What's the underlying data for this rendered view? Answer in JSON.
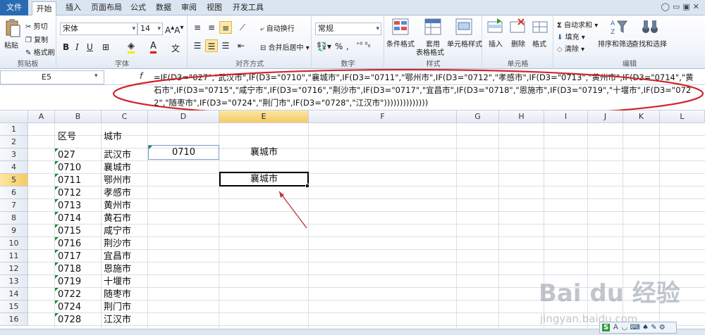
{
  "ribbon_tabs": [
    "文件",
    "开始",
    "插入",
    "页面布局",
    "公式",
    "数据",
    "审阅",
    "视图",
    "开发工具"
  ],
  "active_tab": "开始",
  "clipboard": {
    "paste": "粘贴",
    "cut": "剪切",
    "copy": "复制",
    "format_painter": "格式刷",
    "label": "剪贴板"
  },
  "font": {
    "name": "宋体",
    "size": "14",
    "label": "字体"
  },
  "alignment": {
    "wrap": "自动换行",
    "merge": "合并后居中",
    "label": "对齐方式"
  },
  "number": {
    "format": "常规",
    "percent": "%",
    "comma": ",",
    "label": "数字"
  },
  "styles": {
    "conditional": "条件格式",
    "table_line1": "套用",
    "table_line2": "表格格式",
    "cell_styles": "单元格样式",
    "label": "样式"
  },
  "cells": {
    "insert": "插入",
    "delete": "删除",
    "format": "格式",
    "label": "单元格"
  },
  "editing": {
    "autosum": "自动求和",
    "fill": "填充",
    "clear": "清除",
    "sort": "排序和筛选",
    "find": "查找和选择",
    "label": "编辑"
  },
  "name_box": "E5",
  "fx": "f",
  "formula": "=IF(D3=\"027\",\"武汉市\",IF(D3=\"0710\",\"襄城市\",IF(D3=\"0711\",\"鄂州市\",IF(D3=\"0712\",\"孝感市\",IF(D3=\"0713\",\"黄州市\",IF(D3=\"0714\",\"黄石市\",IF(D3=\"0715\",\"咸宁市\",IF(D3=\"0716\",\"荆沙市\",IF(D3=\"0717\",\"宜昌市\",IF(D3=\"0718\",\"恩施市\",IF(D3=\"0719\",\"十堰市\",IF(D3=\"0722\",\"随枣市\",IF(D3=\"0724\",\"荆门市\",IF(D3=\"0728\",\"江汉市\"))))))))))))))",
  "columns": [
    "A",
    "B",
    "C",
    "D",
    "E",
    "F",
    "G",
    "H",
    "I",
    "J",
    "K",
    "L"
  ],
  "rows": [
    "1",
    "2",
    "3",
    "4",
    "5",
    "6",
    "7",
    "8",
    "9",
    "10",
    "11",
    "12",
    "13",
    "14",
    "15",
    "16"
  ],
  "selected_column": "E",
  "selected_row": "5",
  "headers": {
    "b2": "区号",
    "c2": "城市"
  },
  "table_rows": [
    {
      "code": "027",
      "city": "武汉市"
    },
    {
      "code": "0710",
      "city": "襄城市"
    },
    {
      "code": "0711",
      "city": "鄂州市"
    },
    {
      "code": "0712",
      "city": "孝感市"
    },
    {
      "code": "0713",
      "city": "黄州市"
    },
    {
      "code": "0714",
      "city": "黄石市"
    },
    {
      "code": "0715",
      "city": "咸宁市"
    },
    {
      "code": "0716",
      "city": "荆沙市"
    },
    {
      "code": "0717",
      "city": "宜昌市"
    },
    {
      "code": "0718",
      "city": "恩施市"
    },
    {
      "code": "0719",
      "city": "十堰市"
    },
    {
      "code": "0722",
      "city": "随枣市"
    },
    {
      "code": "0724",
      "city": "荆门市"
    },
    {
      "code": "0728",
      "city": "江汉市"
    }
  ],
  "d3_value": "0710",
  "e3_value": "襄城市",
  "e5_value": "襄城市",
  "ime_label": "S",
  "watermark": {
    "brand": "Bai du 经验",
    "url": "jingyan.baidu.com"
  },
  "colors": {
    "file_tab": "#2a6ab3",
    "selection_header": "#f5cb62",
    "annotation": "#d0262b"
  }
}
